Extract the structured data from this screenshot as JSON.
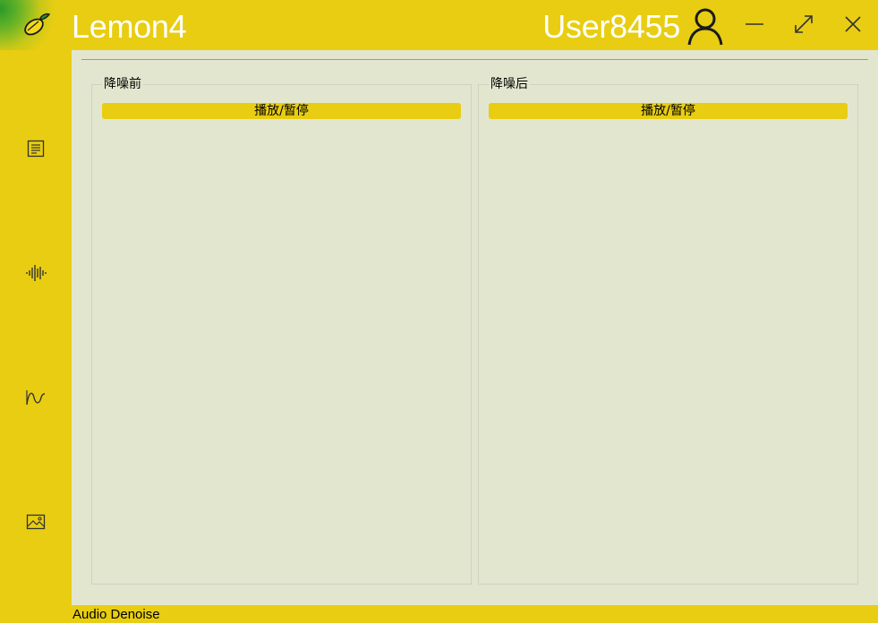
{
  "app": {
    "title": "Lemon4",
    "logo_icon": "lemon-icon"
  },
  "header": {
    "username": "User8455",
    "user_icon": "user-icon",
    "window_controls": [
      "minimize-icon",
      "maximize-icon",
      "close-icon"
    ]
  },
  "sidebar": {
    "items": [
      {
        "icon": "document-icon"
      },
      {
        "icon": "waveform-icon"
      },
      {
        "icon": "signal-curve-icon"
      },
      {
        "icon": "image-icon"
      }
    ]
  },
  "main": {
    "panels": [
      {
        "title": "降噪前",
        "button_label": "播放/暂停"
      },
      {
        "title": "降噪后",
        "button_label": "播放/暂停"
      }
    ]
  },
  "status": {
    "text": "Audio Denoise"
  },
  "colors": {
    "accent": "#e8cd12",
    "content_bg": "#e3e6cf",
    "title_text": "#ffffff"
  }
}
